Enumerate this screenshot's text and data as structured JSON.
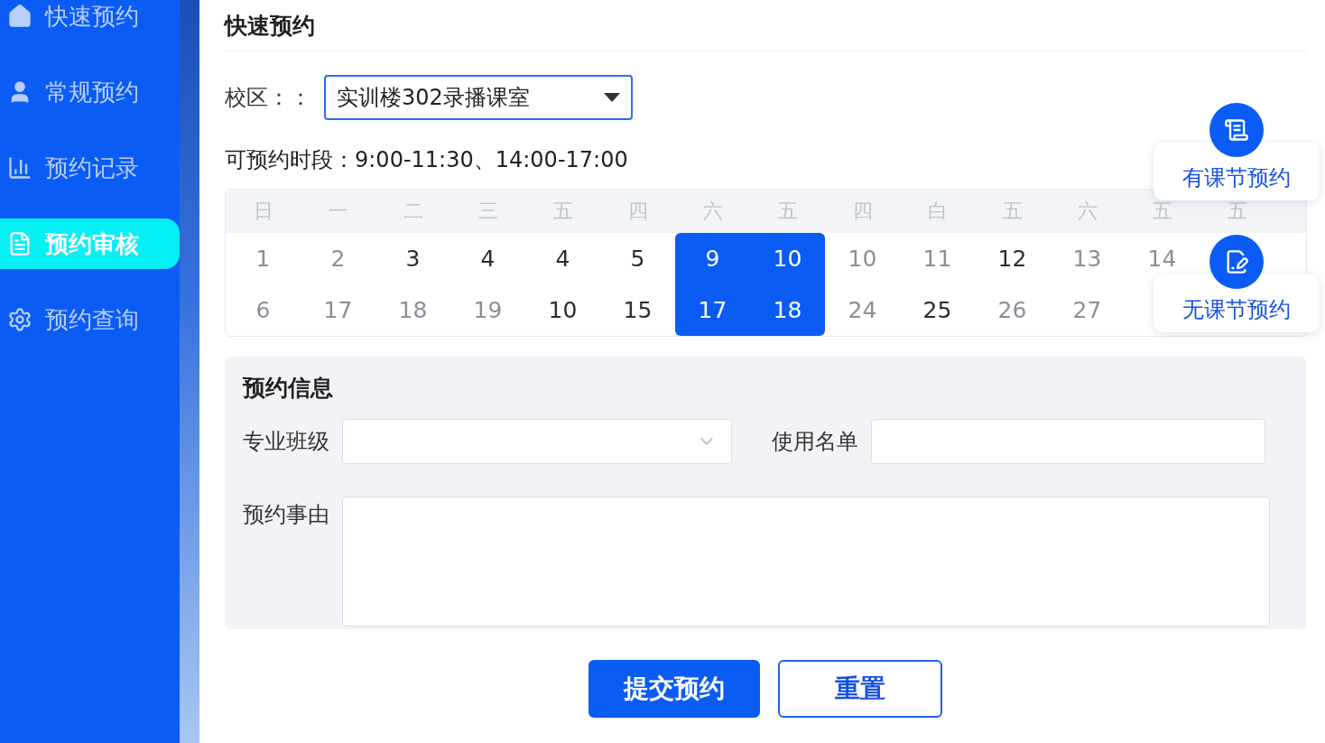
{
  "sidebar": {
    "items": [
      {
        "label": "快速预约",
        "selected": false
      },
      {
        "label": "常规预约",
        "selected": false
      },
      {
        "label": "预约记录",
        "selected": false
      },
      {
        "label": "预约审核",
        "selected": true
      },
      {
        "label": "预约查询",
        "selected": false
      }
    ]
  },
  "page_title": "快速预约",
  "campus": {
    "label": "校区：：",
    "value": "实训楼302录播课室"
  },
  "available_hours": "可预约时段：9:00-11:30、14:00-17:00",
  "calendar": {
    "weekdays": [
      "日",
      "一",
      "二",
      "三",
      "五",
      "四",
      "六",
      "五",
      "四",
      "白",
      "五",
      "六",
      "五",
      "五"
    ],
    "rows": [
      [
        {
          "text": "1",
          "muted": true,
          "selected": false
        },
        {
          "text": "2",
          "muted": true,
          "selected": false
        },
        {
          "text": "3",
          "muted": false,
          "selected": false
        },
        {
          "text": "4",
          "muted": false,
          "selected": false
        },
        {
          "text": "4",
          "muted": false,
          "selected": false
        },
        {
          "text": "5",
          "muted": false,
          "selected": false
        },
        {
          "text": "9",
          "muted": false,
          "selected": true
        },
        {
          "text": "10",
          "muted": false,
          "selected": true
        },
        {
          "text": "10",
          "muted": true,
          "selected": false
        },
        {
          "text": "11",
          "muted": true,
          "selected": false
        },
        {
          "text": "12",
          "muted": false,
          "selected": false
        },
        {
          "text": "13",
          "muted": true,
          "selected": false
        },
        {
          "text": "14",
          "muted": true,
          "selected": false
        }
      ],
      [
        {
          "text": "6",
          "muted": true,
          "selected": false
        },
        {
          "text": "17",
          "muted": true,
          "selected": false
        },
        {
          "text": "18",
          "muted": true,
          "selected": false
        },
        {
          "text": "19",
          "muted": true,
          "selected": false
        },
        {
          "text": "10",
          "muted": false,
          "selected": false
        },
        {
          "text": "15",
          "muted": false,
          "selected": false
        },
        {
          "text": "17",
          "muted": false,
          "selected": true
        },
        {
          "text": "18",
          "muted": false,
          "selected": true
        },
        {
          "text": "24",
          "muted": true,
          "selected": false
        },
        {
          "text": "25",
          "muted": false,
          "selected": false
        },
        {
          "text": "26",
          "muted": true,
          "selected": false
        },
        {
          "text": "27",
          "muted": true,
          "selected": false
        }
      ]
    ]
  },
  "quick_actions": [
    {
      "label": "有课节预约"
    },
    {
      "label": "无课节预约"
    }
  ],
  "booking_info": {
    "title": "预约信息",
    "class_label": "专业班级",
    "list_label": "使用名单",
    "reason_label": "预约事由"
  },
  "buttons": [
    {
      "label": "提交预约",
      "kind": "primary"
    },
    {
      "label": "重置",
      "kind": "secondary"
    }
  ]
}
